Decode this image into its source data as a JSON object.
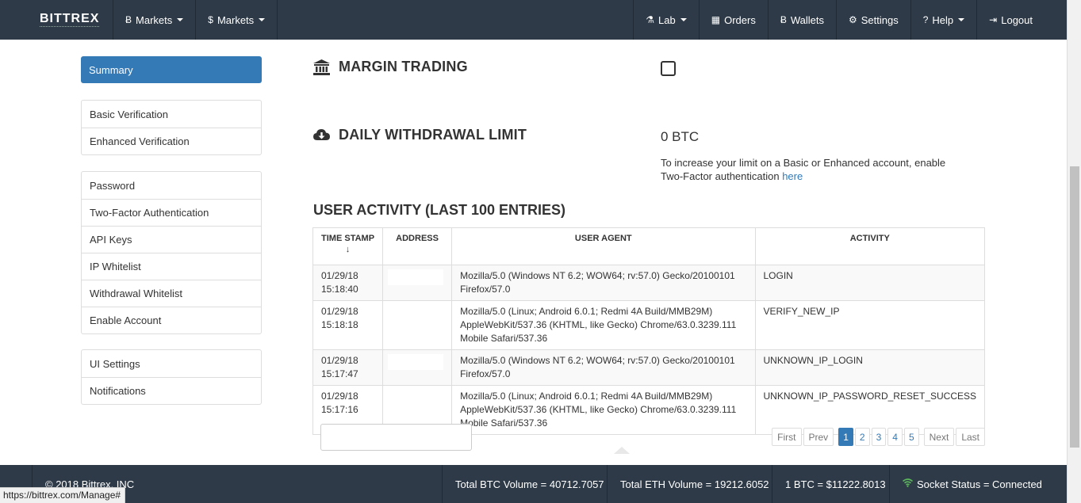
{
  "navbar": {
    "brand": "BITTREX",
    "left": [
      {
        "icon": "bitcoin-icon",
        "glyph": "Ƀ",
        "label": "Markets"
      },
      {
        "icon": "dollar-icon",
        "glyph": "$",
        "label": "Markets"
      }
    ],
    "right": [
      {
        "icon": "flask-icon",
        "glyph": "⚗",
        "label": "Lab",
        "caret": true
      },
      {
        "icon": "calendar-icon",
        "glyph": "▦",
        "label": "Orders"
      },
      {
        "icon": "bitcoin-icon",
        "glyph": "Ƀ",
        "label": "Wallets"
      },
      {
        "icon": "gear-icon",
        "glyph": "⚙",
        "label": "Settings"
      },
      {
        "icon": "question-circle-icon",
        "glyph": "?",
        "label": "Help",
        "caret": true
      },
      {
        "icon": "logout-icon",
        "glyph": "⇥",
        "label": "Logout"
      }
    ]
  },
  "sidebar": {
    "active": "Summary",
    "groups": [
      [
        "Basic Verification",
        "Enhanced Verification"
      ],
      [
        "Password",
        "Two-Factor Authentication",
        "API Keys",
        "IP Whitelist",
        "Withdrawal Whitelist",
        "Enable Account"
      ],
      [
        "UI Settings",
        "Notifications"
      ]
    ]
  },
  "margin": {
    "title": "MARGIN TRADING",
    "icon": "bank-icon",
    "checked": false
  },
  "withdrawal": {
    "title": "DAILY WITHDRAWAL LIMIT",
    "icon": "cloud-download-icon",
    "value": "0 BTC",
    "note": "To increase your limit on a Basic or Enhanced account, enable Two-Factor authentication ",
    "link": "here"
  },
  "activity": {
    "title": "USER ACTIVITY (LAST 100 ENTRIES)",
    "columns": [
      "TIME STAMP",
      "ADDRESS",
      "USER AGENT",
      "ACTIVITY"
    ],
    "rows": [
      {
        "date": "01/29/18",
        "time": "15:18:40",
        "address": "",
        "agent": "Mozilla/5.0 (Windows NT 6.2; WOW64; rv:57.0) Gecko/20100101 Firefox/57.0",
        "activity": "LOGIN"
      },
      {
        "date": "01/29/18",
        "time": "15:18:18",
        "address": "",
        "agent": "Mozilla/5.0 (Linux; Android 6.0.1; Redmi 4A Build/MMB29M) AppleWebKit/537.36 (KHTML, like Gecko) Chrome/63.0.3239.111 Mobile Safari/537.36",
        "activity": "VERIFY_NEW_IP"
      },
      {
        "date": "01/29/18",
        "time": "15:17:47",
        "address": "",
        "agent": "Mozilla/5.0 (Windows NT 6.2; WOW64; rv:57.0) Gecko/20100101 Firefox/57.0",
        "activity": "UNKNOWN_IP_LOGIN"
      },
      {
        "date": "01/29/18",
        "time": "15:17:16",
        "address": "",
        "agent": "Mozilla/5.0 (Linux; Android 6.0.1; Redmi 4A Build/MMB29M) AppleWebKit/537.36 (KHTML, like Gecko) Chrome/63.0.3239.111 Mobile Safari/537.36",
        "activity": "UNKNOWN_IP_PASSWORD_RESET_SUCCESS"
      }
    ],
    "filter_value": "",
    "pagination": {
      "first": "First",
      "prev": "Prev",
      "pages": [
        "1",
        "2",
        "3",
        "4",
        "5"
      ],
      "current": "1",
      "next": "Next",
      "last": "Last"
    }
  },
  "footer": {
    "copyright": "© 2018 Bittrex, INC",
    "btc_volume": "Total BTC Volume = 40712.7057",
    "eth_volume": "Total ETH Volume = 19212.6052",
    "btc_price": "1 BTC = $11222.8013",
    "socket": "Socket Status = Connected"
  },
  "status_bar_url": "https://bittrex.com/Manage#",
  "colors": {
    "navbar": "#2e3a47",
    "accent": "#337ab7",
    "socket_ok": "#5cb85c"
  }
}
